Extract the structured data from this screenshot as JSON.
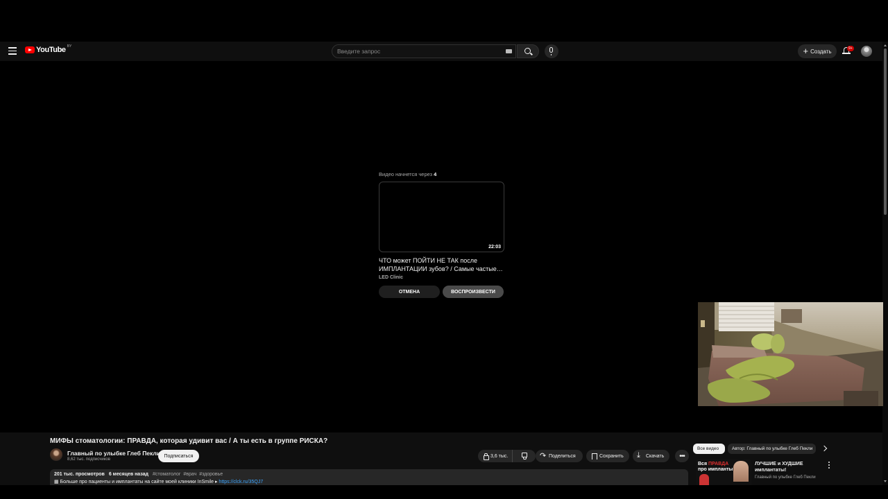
{
  "header": {
    "logo_text": "YouTube",
    "logo_region": "BY",
    "search_placeholder": "Введите запрос",
    "create_label": "Создать",
    "notifications_badge": "9+"
  },
  "up_next": {
    "header_prefix": "Видео начнется через",
    "countdown": "4",
    "duration": "22:03",
    "title": "ЧТО может ПОЙТИ НЕ ТАК после ИМПЛАНТАЦИИ зубов? / Самые частые…",
    "channel": "LED Clinic",
    "cancel_label": "ОТМЕНА",
    "play_label": "ВОСПРОИЗВЕСТИ"
  },
  "video": {
    "title": "МИФЫ стоматологии: ПРАВДА, которая удивит вас / А ты есть в группе РИСКА?",
    "channel_name": "Главный по улыбке Глеб Пекли",
    "subscribers": "8,62 тыс. подписчиков",
    "subscribe_label": "Подписаться",
    "likes": "3,6 тыс.",
    "share_label": "Поделиться",
    "save_label": "Сохранить",
    "download_label": "Скачать",
    "more_label": "•••"
  },
  "description": {
    "views": "201 тыс. просмотров",
    "date": "6 месяцев назад",
    "tags": [
      "#стоматолог",
      "#врач",
      "#здоровье"
    ],
    "line2_text": "▦ Больше про пациенты и имплантаты на сайте моей клиники InSmile ▸",
    "line2_link": "https://clck.ru/35QJ7"
  },
  "sidebar": {
    "chip_all": "Все видео",
    "chip_author": "Автор: Главный по улыбке Глеб Пекли",
    "rec_thumb_line1_prefix": "Вся",
    "rec_thumb_line1_highlight": "ПРАВДА",
    "rec_thumb_line2": "про импланты",
    "rec_title": "ЛУЧШИЕ и ХУДШИЕ имплантаты!",
    "rec_channel": "Главный по улыбке Глеб Пекли"
  },
  "colors": {
    "background": "#0f0f0f",
    "logo_red": "#ff0000",
    "link_blue": "#3ea6ff",
    "badge_red": "#cc0000"
  }
}
